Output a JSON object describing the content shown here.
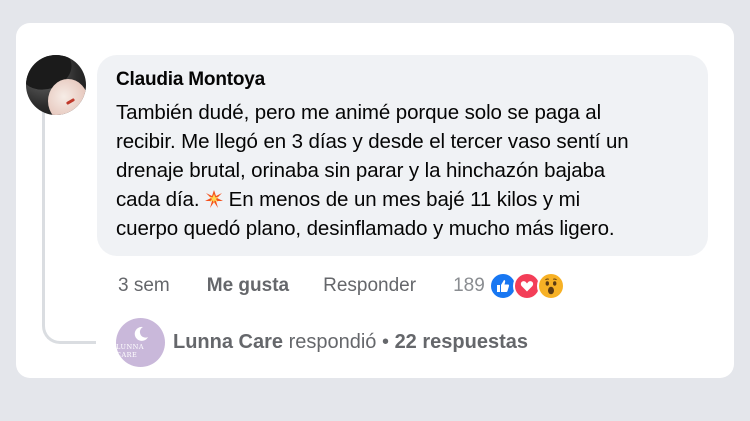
{
  "comment": {
    "author": "Claudia Montoya",
    "lines": [
      "También dudé, pero me animé porque solo se paga al",
      "recibir. Me llegó en 3 días y desde el tercer vaso sentí un",
      "drenaje brutal, orinaba sin parar y la hinchazón bajaba",
      "cada día.",
      " En menos de un mes bajé 11 kilos y mi",
      "cuerpo quedó plano, desinflamado y mucho más ligero."
    ],
    "emoji": "collision-icon"
  },
  "actions": {
    "time": "3 sem",
    "like_label": "Me gusta",
    "reply_label": "Responder",
    "reaction_count": "189",
    "reactions": [
      "like-icon",
      "love-icon",
      "wow-icon"
    ]
  },
  "reply": {
    "avatar_text": "LUNNA CARE",
    "name": "Lunna Care",
    "verb": " respondió",
    "separator": " • ",
    "count_label": "22 respuestas"
  },
  "colors": {
    "page_bg": "#e4e6eb",
    "bubble_bg": "#f0f2f5",
    "like": "#1877f2",
    "love": "#f33e58",
    "wow": "#f7b125",
    "lunna_avatar": "#c9b8da"
  }
}
